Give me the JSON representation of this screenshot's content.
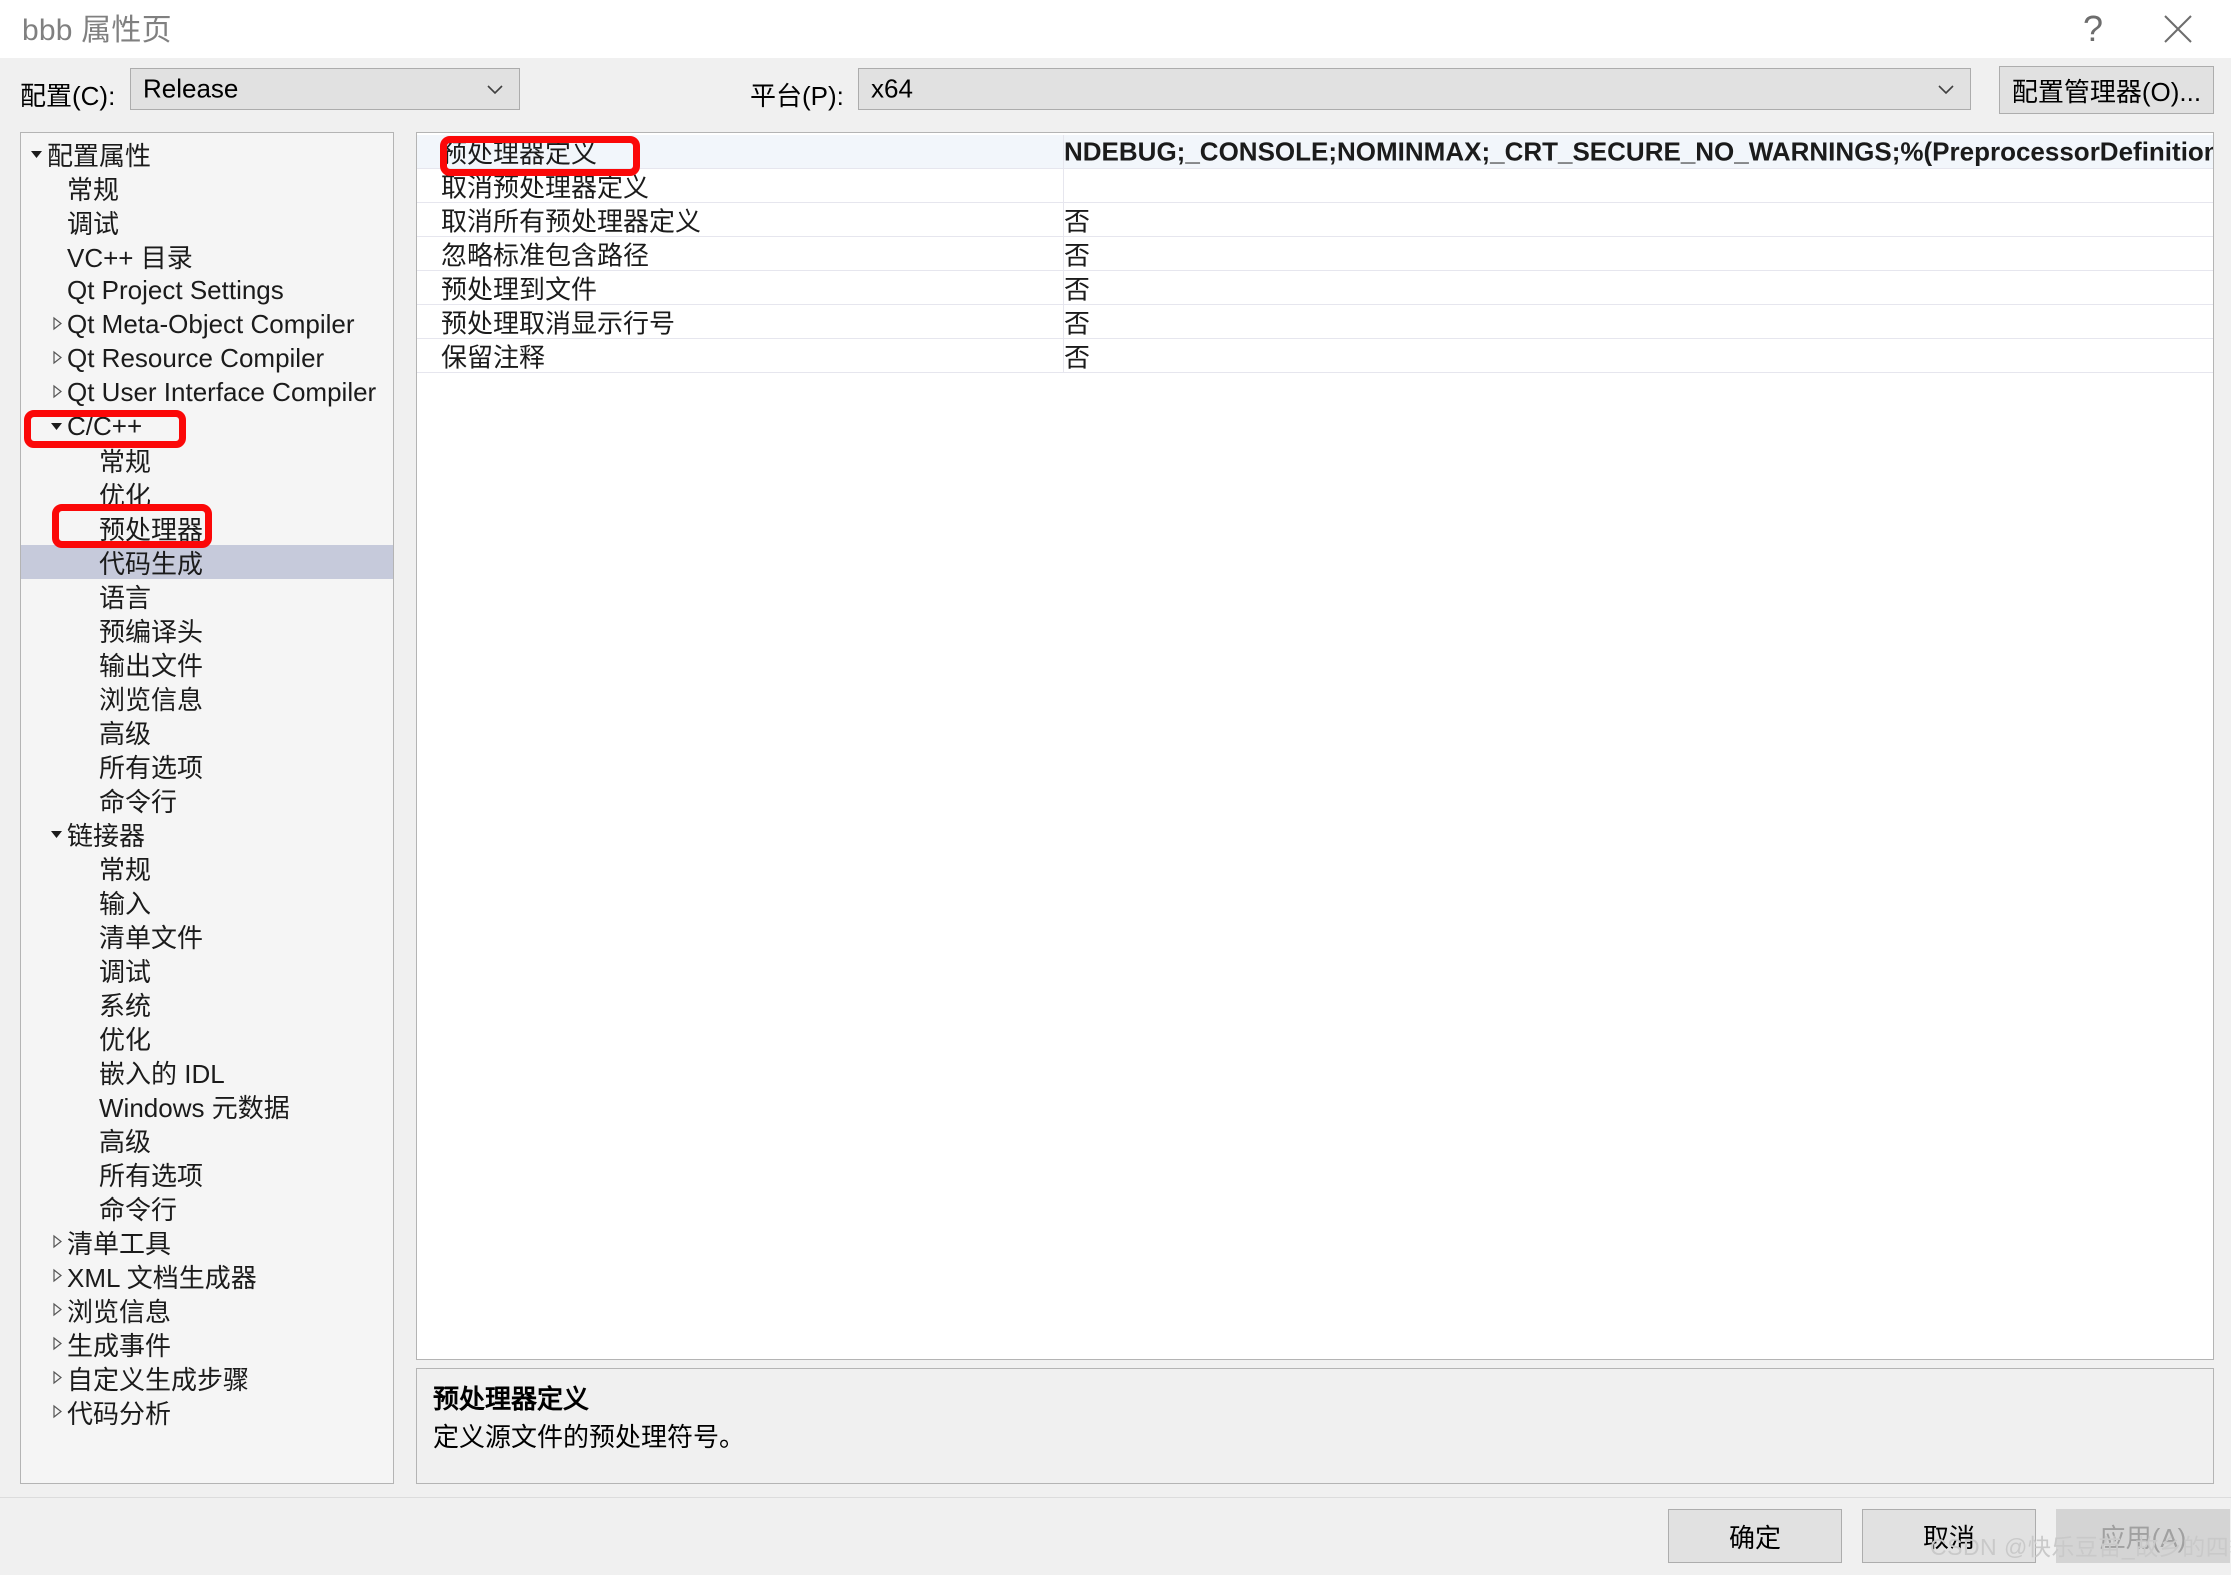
{
  "window": {
    "title": "bbb 属性页",
    "help_icon": "question-mark-icon",
    "help_glyph": "?",
    "close_icon": "close-icon"
  },
  "configbar": {
    "config_label": "配置(C):",
    "config_value": "Release",
    "platform_label": "平台(P):",
    "platform_value": "x64",
    "config_manager_button": "配置管理器(O)..."
  },
  "tree": {
    "selected_index": 12,
    "items": [
      {
        "label": "配置属性",
        "indent": 0,
        "arrow": "expanded"
      },
      {
        "label": "常规",
        "indent": 1,
        "arrow": "none"
      },
      {
        "label": "调试",
        "indent": 1,
        "arrow": "none"
      },
      {
        "label": "VC++ 目录",
        "indent": 1,
        "arrow": "none"
      },
      {
        "label": "Qt Project Settings",
        "indent": 1,
        "arrow": "none"
      },
      {
        "label": "Qt Meta-Object Compiler",
        "indent": 1,
        "arrow": "collapsed"
      },
      {
        "label": "Qt Resource Compiler",
        "indent": 1,
        "arrow": "collapsed"
      },
      {
        "label": "Qt User Interface Compiler",
        "indent": 1,
        "arrow": "collapsed"
      },
      {
        "label": "C/C++",
        "indent": 1,
        "arrow": "expanded"
      },
      {
        "label": "常规",
        "indent": 2,
        "arrow": "none"
      },
      {
        "label": "优化",
        "indent": 2,
        "arrow": "none"
      },
      {
        "label": "预处理器",
        "indent": 2,
        "arrow": "none"
      },
      {
        "label": "代码生成",
        "indent": 2,
        "arrow": "none"
      },
      {
        "label": "语言",
        "indent": 2,
        "arrow": "none"
      },
      {
        "label": "预编译头",
        "indent": 2,
        "arrow": "none"
      },
      {
        "label": "输出文件",
        "indent": 2,
        "arrow": "none"
      },
      {
        "label": "浏览信息",
        "indent": 2,
        "arrow": "none"
      },
      {
        "label": "高级",
        "indent": 2,
        "arrow": "none"
      },
      {
        "label": "所有选项",
        "indent": 2,
        "arrow": "none"
      },
      {
        "label": "命令行",
        "indent": 2,
        "arrow": "none"
      },
      {
        "label": "链接器",
        "indent": 1,
        "arrow": "expanded"
      },
      {
        "label": "常规",
        "indent": 2,
        "arrow": "none"
      },
      {
        "label": "输入",
        "indent": 2,
        "arrow": "none"
      },
      {
        "label": "清单文件",
        "indent": 2,
        "arrow": "none"
      },
      {
        "label": "调试",
        "indent": 2,
        "arrow": "none"
      },
      {
        "label": "系统",
        "indent": 2,
        "arrow": "none"
      },
      {
        "label": "优化",
        "indent": 2,
        "arrow": "none"
      },
      {
        "label": "嵌入的 IDL",
        "indent": 2,
        "arrow": "none"
      },
      {
        "label": "Windows 元数据",
        "indent": 2,
        "arrow": "none"
      },
      {
        "label": "高级",
        "indent": 2,
        "arrow": "none"
      },
      {
        "label": "所有选项",
        "indent": 2,
        "arrow": "none"
      },
      {
        "label": "命令行",
        "indent": 2,
        "arrow": "none"
      },
      {
        "label": "清单工具",
        "indent": 1,
        "arrow": "collapsed"
      },
      {
        "label": "XML 文档生成器",
        "indent": 1,
        "arrow": "collapsed"
      },
      {
        "label": "浏览信息",
        "indent": 1,
        "arrow": "collapsed"
      },
      {
        "label": "生成事件",
        "indent": 1,
        "arrow": "collapsed"
      },
      {
        "label": "自定义生成步骤",
        "indent": 1,
        "arrow": "collapsed"
      },
      {
        "label": "代码分析",
        "indent": 1,
        "arrow": "collapsed"
      }
    ]
  },
  "grid": {
    "selected_index": 0,
    "rows": [
      {
        "name": "预处理器定义",
        "value": "NDEBUG;_CONSOLE;NOMINMAX;_CRT_SECURE_NO_WARNINGS;%(PreprocessorDefinitions)"
      },
      {
        "name": "取消预处理器定义",
        "value": ""
      },
      {
        "name": "取消所有预处理器定义",
        "value": "否"
      },
      {
        "name": "忽略标准包含路径",
        "value": "否"
      },
      {
        "name": "预处理到文件",
        "value": "否"
      },
      {
        "name": "预处理取消显示行号",
        "value": "否"
      },
      {
        "name": "保留注释",
        "value": "否"
      }
    ]
  },
  "description": {
    "title": "预处理器定义",
    "text": "定义源文件的预处理符号。"
  },
  "footer": {
    "ok": "确定",
    "cancel": "取消",
    "apply": "应用(A)"
  },
  "watermark": "CSDN @快乐豆苗_故乡的四季",
  "colors": {
    "dialog_bg": "#f0f0f0",
    "tree_bg": "#f5f5f5",
    "tree_selection": "#c6cadb",
    "grid_selection": "#f2f6fb",
    "annotation_red": "#fb0808",
    "border": "#b4b4b4"
  }
}
